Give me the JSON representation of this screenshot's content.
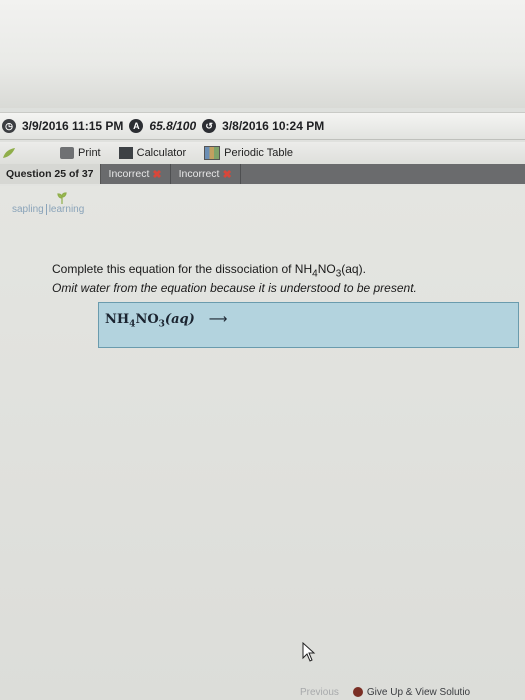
{
  "status": {
    "date_time": "3/9/2016 11:15 PM",
    "score": "65.8/100",
    "due_date_time": "3/8/2016 10:24 PM",
    "score_icon_letter": "A"
  },
  "toolbar": {
    "print_label": "Print",
    "calculator_label": "Calculator",
    "periodic_table_label": "Periodic Table"
  },
  "tabs": {
    "question_label": "Question 25 of 37",
    "attempts": [
      {
        "label": "Incorrect"
      },
      {
        "label": "Incorrect"
      }
    ]
  },
  "logo": {
    "part1": "sapling",
    "part2": "learning"
  },
  "question": {
    "line1_prefix": "Complete this equation for the dissociation of NH",
    "sub4": "4",
    "mid": "NO",
    "sub3": "3",
    "aq": "(aq).",
    "line2": "Omit water from the equation because it is understood to be present."
  },
  "answer": {
    "nh": "NH",
    "sub4": "4",
    "no": "NO",
    "sub3": "3",
    "state": "(aq)",
    "arrow": "⟶"
  },
  "footer": {
    "previous_label": "Previous",
    "give_up_label": "Give Up & View Solutio"
  },
  "colors": {
    "answer_box_bg": "#b3d3de",
    "incorrect_icon": "#d9473a"
  }
}
